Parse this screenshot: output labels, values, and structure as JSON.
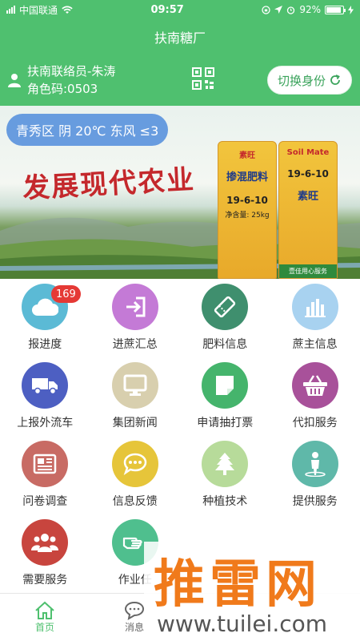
{
  "status_bar": {
    "carrier": "中国联通",
    "time": "09:57",
    "battery": "92%",
    "battery_level": 0.92
  },
  "nav": {
    "title": "扶南糖厂"
  },
  "user": {
    "name_line": "扶南联络员-朱涛",
    "role_code_line": "角色码:0503",
    "switch_label": "切换身份"
  },
  "banner": {
    "weather": "青秀区 阴 20℃ 东风 ≤3",
    "slogan": "发展现代农业",
    "bag_brand": "Soil Mate",
    "bag_cn_brand": "素旺",
    "bag_name": "掺混肥料",
    "bag_formula": "19-6-10",
    "bag_net": "净含量: 25kg",
    "bag_footer": "壹佳用心服务"
  },
  "grid": [
    {
      "name": "progress",
      "label": "报进度",
      "color": "#5bbad5",
      "icon": "cloud-icon",
      "badge": "169"
    },
    {
      "name": "cane-summary",
      "label": "进蔗汇总",
      "color": "#c47ad6",
      "icon": "enter-icon"
    },
    {
      "name": "fertilizer-info",
      "label": "肥料信息",
      "color": "#3f8f6e",
      "icon": "ticket-icon"
    },
    {
      "name": "grower-info",
      "label": "蔗主信息",
      "color": "#a8d2f0",
      "icon": "bar-chart-icon"
    },
    {
      "name": "report-truck",
      "label": "上报外流车",
      "color": "#4d5fc2",
      "icon": "truck-icon"
    },
    {
      "name": "group-news",
      "label": "集团新闻",
      "color": "#d8cfae",
      "icon": "monitor-icon"
    },
    {
      "name": "apply-ticket",
      "label": "申请抽打票",
      "color": "#45b46c",
      "icon": "note-icon"
    },
    {
      "name": "deduction-service",
      "label": "代扣服务",
      "color": "#a8519a",
      "icon": "basket-icon"
    },
    {
      "name": "survey",
      "label": "问卷调查",
      "color": "#c86b64",
      "icon": "newspaper-icon"
    },
    {
      "name": "feedback",
      "label": "信息反馈",
      "color": "#e6c53a",
      "icon": "chat-icon"
    },
    {
      "name": "planting-tech",
      "label": "种植技术",
      "color": "#b7db9a",
      "icon": "tree-icon"
    },
    {
      "name": "provide-service",
      "label": "提供服务",
      "color": "#5fb8a9",
      "icon": "person-icon"
    },
    {
      "name": "need-service",
      "label": "需要服务",
      "color": "#c8453e",
      "icon": "group-icon"
    },
    {
      "name": "work-task",
      "label": "作业任",
      "color": "#4fbf8e",
      "icon": "hand-icon"
    }
  ],
  "tabs": [
    {
      "label": "首页",
      "icon": "home-icon",
      "active": true
    },
    {
      "label": "消息",
      "icon": "message-icon",
      "active": false
    }
  ],
  "watermark": {
    "text": "推雷网",
    "url": "www.tuilei.com"
  }
}
